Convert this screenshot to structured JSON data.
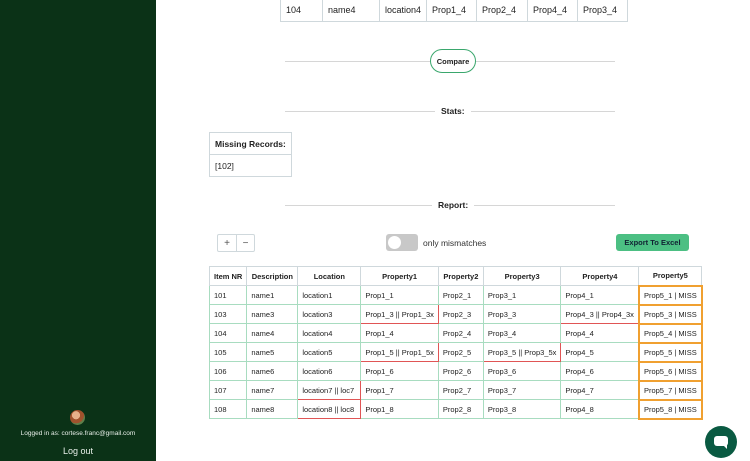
{
  "sidebar": {
    "logged_in_text": "Logged in as: cortese.franc@gmail.com",
    "logout_label": "Log out"
  },
  "top_row": [
    "104",
    "name4",
    "location4",
    "Prop1_4",
    "Prop2_4",
    "Prop4_4",
    "Prop3_4"
  ],
  "compare_label": "Compare",
  "stats": {
    "label": "Stats:",
    "missing_header": "Missing Records:",
    "missing_value": "[102]"
  },
  "report": {
    "label": "Report:",
    "zoom_in": "+",
    "zoom_out": "−",
    "toggle_label": "only mismatches",
    "toggle_on": false,
    "export_label": "Export To Excel",
    "columns": [
      "Item NR",
      "Description",
      "Location",
      "Property1",
      "Property2",
      "Property3",
      "Property4",
      "Property5"
    ],
    "rows": [
      [
        "101",
        "name1",
        "location1",
        "Prop1_1",
        "Prop2_1",
        "Prop3_1",
        "Prop4_1",
        "Prop5_1 | MISS"
      ],
      [
        "103",
        "name3",
        "location3",
        "Prop1_3 || Prop1_3x",
        "Prop2_3",
        "Prop3_3",
        "Prop4_3 || Prop4_3x",
        "Prop5_3 | MISS"
      ],
      [
        "104",
        "name4",
        "location4",
        "Prop1_4",
        "Prop2_4",
        "Prop3_4",
        "Prop4_4",
        "Prop5_4 | MISS"
      ],
      [
        "105",
        "name5",
        "location5",
        "Prop1_5 || Prop1_5x",
        "Prop2_5",
        "Prop3_5 || Prop3_5x",
        "Prop4_5",
        "Prop5_5 | MISS"
      ],
      [
        "106",
        "name6",
        "location6",
        "Prop1_6",
        "Prop2_6",
        "Prop3_6",
        "Prop4_6",
        "Prop5_6 | MISS"
      ],
      [
        "107",
        "name7",
        "location7 || loc7",
        "Prop1_7",
        "Prop2_7",
        "Prop3_7",
        "Prop4_7",
        "Prop5_7 | MISS"
      ],
      [
        "108",
        "name8",
        "location8 || loc8",
        "Prop1_8",
        "Prop2_8",
        "Prop3_8",
        "Prop4_8",
        "Prop5_8 | MISS"
      ]
    ],
    "cell_status": [
      [
        "",
        "",
        "",
        "",
        "",
        "",
        "",
        "miss"
      ],
      [
        "",
        "",
        "",
        "diff",
        "",
        "",
        "diff",
        "miss"
      ],
      [
        "",
        "",
        "",
        "",
        "",
        "",
        "",
        "miss"
      ],
      [
        "",
        "",
        "",
        "diff",
        "",
        "diff",
        "",
        "miss"
      ],
      [
        "",
        "",
        "",
        "",
        "",
        "",
        "",
        "miss"
      ],
      [
        "",
        "",
        "diff",
        "",
        "",
        "",
        "",
        "miss"
      ],
      [
        "",
        "",
        "diff",
        "",
        "",
        "",
        "",
        "miss"
      ]
    ]
  },
  "colors": {
    "sidebar_bg": "#0b3217",
    "accent_green": "#4cbf83",
    "mismatch_red": "#e05555",
    "missing_orange": "#f0a030",
    "chat_bg": "#0a5a42"
  },
  "icons": {
    "chat": "chat-bubble-icon",
    "avatar": "user-avatar"
  }
}
